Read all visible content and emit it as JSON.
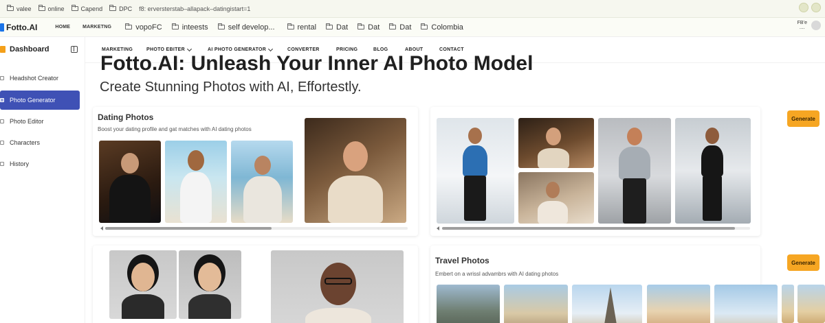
{
  "browser": {
    "bookmarks_top": [
      "valee",
      "online",
      "Capend",
      "DPC"
    ],
    "url_text": "f8: erversterstab–allapack–datingistart=1"
  },
  "site_header": {
    "logo": "Fotto.AI",
    "nav": [
      "HOME",
      "MARKETNG"
    ],
    "bookmarks": [
      "vopoFC",
      "inteests",
      "self develop...",
      "rental",
      "Dat",
      "Dat",
      "Dat",
      "Colombia"
    ],
    "right_label": "FB’e\n...."
  },
  "sidebar": {
    "title": "Dashboard",
    "items": [
      {
        "label": "Headshot Creator",
        "active": false
      },
      {
        "label": "Photo Generator",
        "active": true
      },
      {
        "label": "Photo Editor",
        "active": false
      },
      {
        "label": "Characters",
        "active": false
      },
      {
        "label": "History",
        "active": false
      }
    ],
    "active_color": "#3f51b5"
  },
  "site_nav": {
    "items": [
      {
        "label": "MARKETING",
        "dropdown": false
      },
      {
        "label": "PHOTO EBITER",
        "dropdown": true
      },
      {
        "label": "AI PHOTO GENERATOR",
        "dropdown": true
      },
      {
        "label": "CONVERTER",
        "dropdown": false
      },
      {
        "label": "PRICING",
        "dropdown": false
      },
      {
        "label": "BLOG",
        "dropdown": false
      },
      {
        "label": "ABOUT",
        "dropdown": false
      },
      {
        "label": "CONTACT",
        "dropdown": false
      }
    ]
  },
  "hero": {
    "title": "Fotto.AI: Unleash Your Inner AI Photo Model",
    "subtitle": "Create Stunning Photos with AI, Effortestly."
  },
  "cards": {
    "dating": {
      "title": "Dating Photos",
      "description": "Boost your dating profile and gat matches with AI dating photos",
      "scroll_position": 0.55
    },
    "fitness": {
      "generate_label": "Generate",
      "scroll_position": 0.95
    },
    "travel": {
      "title": "Travel Photos",
      "description": "Embert on a wrissl advambrs with AI dating photos",
      "generate_label": "Generate"
    }
  },
  "colors": {
    "accent": "#f6a623",
    "sidebar_active": "#3f51b5"
  }
}
